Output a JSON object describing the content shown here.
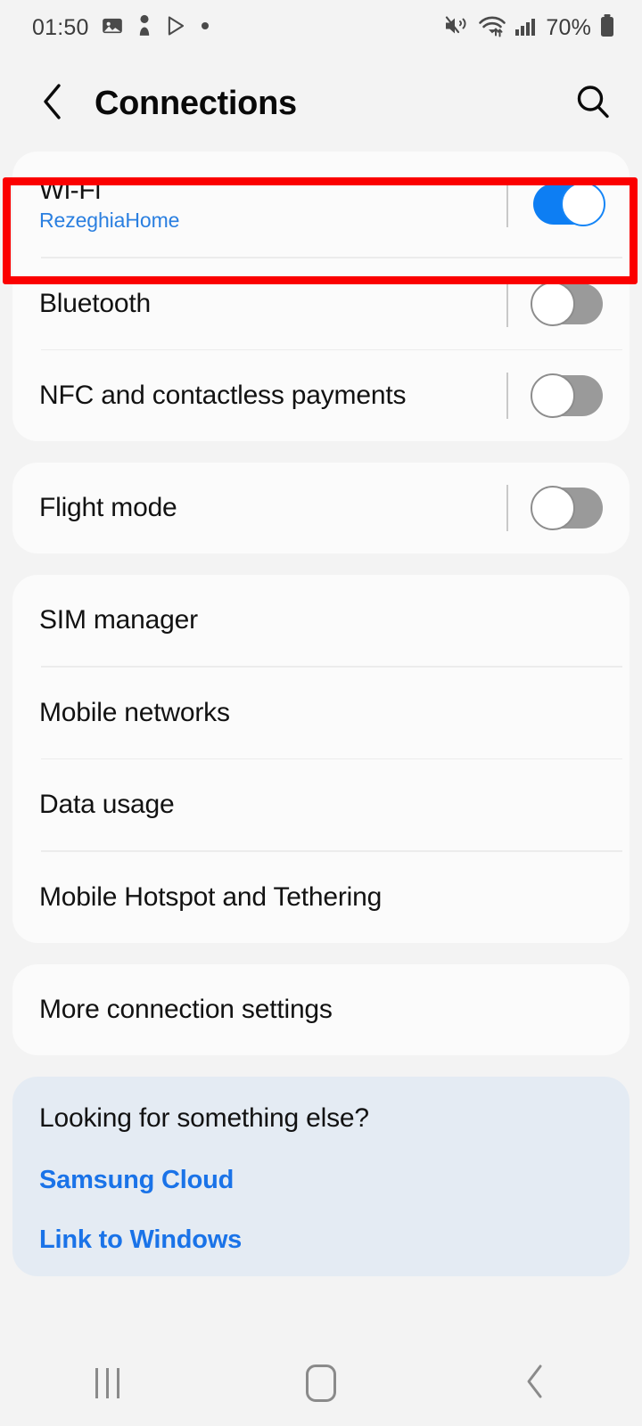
{
  "status_bar": {
    "time": "01:50",
    "battery_percent": "70%",
    "left_icons": [
      "image-icon",
      "person-icon",
      "play-store-icon",
      "dot-icon"
    ],
    "right_icons": [
      "mute-vibrate-icon",
      "wifi-transfer-icon",
      "signal-bars-icon",
      "battery-icon"
    ]
  },
  "header": {
    "title": "Connections",
    "back_icon": "chevron-left-icon",
    "search_icon": "search-icon"
  },
  "groups": [
    {
      "id": "group-wireless",
      "tinted": false,
      "rows": [
        {
          "title": "Wi-Fi",
          "subtitle": "RezeghiaHome",
          "control": "toggle",
          "state": "on",
          "highlighted": true
        },
        {
          "title": "Bluetooth",
          "subtitle": "",
          "control": "toggle",
          "state": "off",
          "highlighted": false
        },
        {
          "title": "NFC and contactless payments",
          "subtitle": "",
          "control": "toggle",
          "state": "off",
          "highlighted": false
        }
      ]
    },
    {
      "id": "group-flight",
      "tinted": false,
      "rows": [
        {
          "title": "Flight mode",
          "subtitle": "",
          "control": "toggle",
          "state": "off",
          "highlighted": false
        }
      ]
    },
    {
      "id": "group-network",
      "tinted": false,
      "rows": [
        {
          "title": "SIM manager",
          "subtitle": "",
          "control": "none",
          "state": "",
          "highlighted": false
        },
        {
          "title": "Mobile networks",
          "subtitle": "",
          "control": "none",
          "state": "",
          "highlighted": false
        },
        {
          "title": "Data usage",
          "subtitle": "",
          "control": "none",
          "state": "",
          "highlighted": false
        },
        {
          "title": "Mobile Hotspot and Tethering",
          "subtitle": "",
          "control": "none",
          "state": "",
          "highlighted": false
        }
      ]
    },
    {
      "id": "group-more",
      "tinted": false,
      "rows": [
        {
          "title": "More connection settings",
          "subtitle": "",
          "control": "none",
          "state": "",
          "highlighted": false
        }
      ]
    }
  ],
  "promo": {
    "title": "Looking for something else?",
    "link_1": "Samsung Cloud",
    "link_2": "Link to Windows"
  },
  "nav_bar": {
    "recents_icon": "recents-icon",
    "home_icon": "home-icon",
    "back_icon": "back-chevron-icon"
  },
  "colors": {
    "accent_blue": "#0d7ef3",
    "link_blue": "#1a73e8",
    "subtitle_blue": "#2a7fe0",
    "highlight_red": "#fb0000",
    "page_bg": "#f3f3f3",
    "card_bg": "#fbfbfb",
    "tinted_card_bg": "#e4ebf3",
    "toggle_off": "#9a9a9a"
  }
}
